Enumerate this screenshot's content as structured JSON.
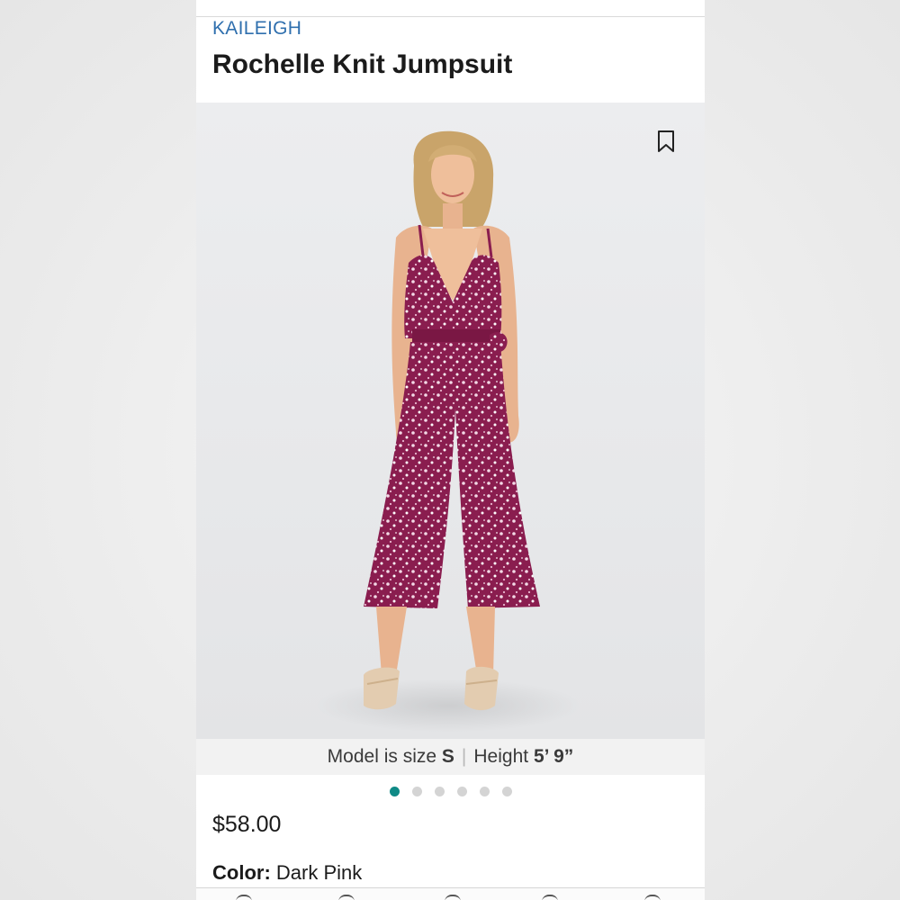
{
  "product": {
    "brand": "KAILEIGH",
    "title": "Rochelle Knit Jumpsuit",
    "price": "$58.00",
    "color_label": "Color:",
    "color_value": "Dark Pink"
  },
  "gallery": {
    "model_info_prefix": "Model is size",
    "model_size": "S",
    "height_prefix": "Height",
    "model_height": "5’ 9”",
    "total_images": 6,
    "active_index": 0,
    "save_icon": "bookmark-icon"
  },
  "colors": {
    "brand_blue": "#2f6fae",
    "active_dot": "#0f8a86",
    "inactive_dot": "#d4d4d4",
    "jumpsuit": "#8e1f52"
  }
}
